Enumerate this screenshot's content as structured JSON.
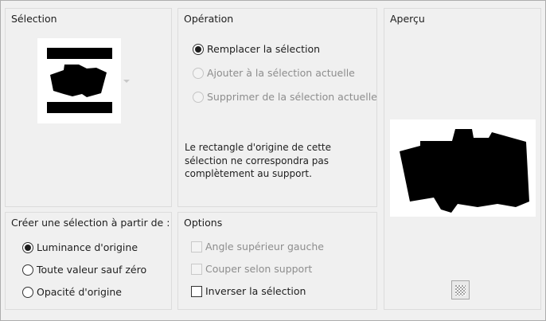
{
  "selection": {
    "title": "Sélection"
  },
  "operation": {
    "title": "Opération",
    "options": [
      {
        "label": "Remplacer la sélection",
        "checked": true,
        "enabled": true
      },
      {
        "label": "Ajouter à la sélection actuelle",
        "checked": false,
        "enabled": false
      },
      {
        "label": "Supprimer de la sélection actuelle",
        "checked": false,
        "enabled": false
      }
    ],
    "note_lines": [
      "Le rectangle d'origine de cette",
      "sélection ne correspondra pas",
      "complètement au support."
    ]
  },
  "preview": {
    "title": "Aperçu",
    "checker_icon": "checkerboard-icon"
  },
  "create_from": {
    "title": "Créer une sélection à partir de :",
    "options": [
      {
        "label": "Luminance d'origine",
        "checked": true
      },
      {
        "label": "Toute valeur sauf zéro",
        "checked": false
      },
      {
        "label": "Opacité d'origine",
        "checked": false
      }
    ]
  },
  "options": {
    "title": "Options",
    "items": [
      {
        "label": "Angle supérieur gauche",
        "checked": false,
        "enabled": false
      },
      {
        "label": "Couper selon support",
        "checked": false,
        "enabled": false
      },
      {
        "label": "Inverser la sélection",
        "checked": false,
        "enabled": true
      }
    ]
  }
}
